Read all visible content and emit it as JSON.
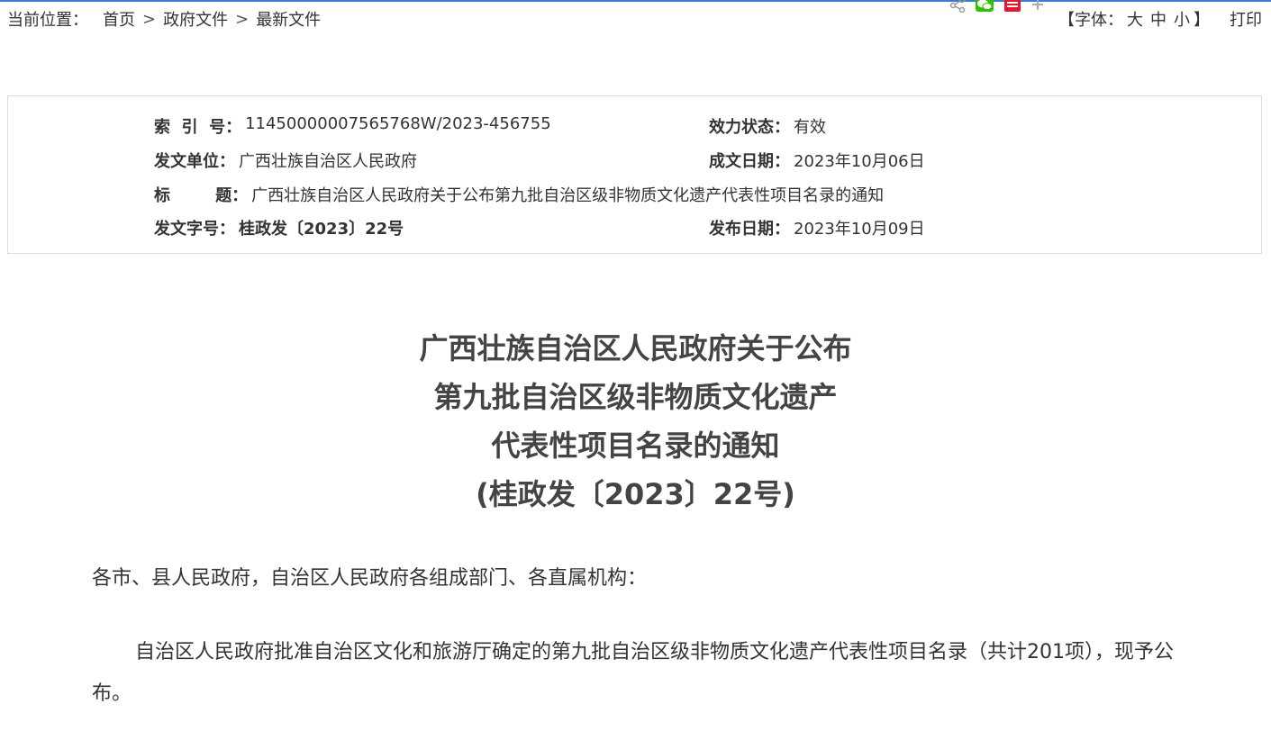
{
  "breadcrumb": {
    "label": "当前位置：",
    "items": [
      "首页",
      "政府文件",
      "最新文件"
    ],
    "separator": ">"
  },
  "share": {
    "icons": [
      "share-icon",
      "wechat-icon",
      "weibo-icon",
      "plus-icon"
    ],
    "colors": {
      "wechat": "#2dc100",
      "weibo": "#e6162d",
      "share": "#999999"
    }
  },
  "tools": {
    "font_prefix": "【字体：",
    "sizes": [
      "大",
      "中",
      "小"
    ],
    "font_suffix": "】",
    "print": "打印"
  },
  "info": {
    "index_key": "索  引  号：",
    "index_val": "11450000007565768W/2023-456755",
    "status_key": "效力状态：",
    "status_val": "有效",
    "issuer_key": "发文单位：",
    "issuer_val": "广西壮族自治区人民政府",
    "date_written_key": "成文日期：",
    "date_written_val": "2023年10月06日",
    "title_key": "标        题：",
    "title_val": "广西壮族自治区人民政府关于公布第九批自治区级非物质文化遗产代表性项目名录的通知",
    "docno_key": "发文字号：",
    "docno_val": "桂政发〔2023〕22号",
    "publish_key": "发布日期：",
    "publish_val": "2023年10月09日"
  },
  "document": {
    "title_lines": [
      "广西壮族自治区人民政府关于公布",
      "第九批自治区级非物质文化遗产",
      "代表性项目名录的通知",
      "(桂政发〔2023〕22号)"
    ],
    "salutation": "各市、县人民政府，自治区人民政府各组成部门、各直属机构：",
    "paragraph1": "自治区人民政府批准自治区文化和旅游厅确定的第九批自治区级非物质文化遗产代表性项目名录（共计201项），现予公布。"
  },
  "colors": {
    "accent_line": "#3a7bd5",
    "border": "#dcdcdc",
    "text": "#333333"
  }
}
